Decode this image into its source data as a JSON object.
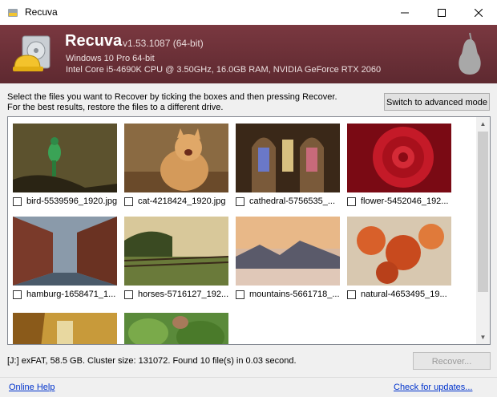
{
  "window": {
    "title": "Recuva"
  },
  "header": {
    "app_name": "Recuva",
    "version": "v1.53.1087 (64-bit)",
    "os": "Windows 10 Pro 64-bit",
    "hardware": "Intel Core i5-4690K CPU @ 3.50GHz, 16.0GB RAM, NVIDIA GeForce RTX 2060"
  },
  "instructions": {
    "line1": "Select the files you want to Recover by ticking the boxes and then pressing Recover.",
    "line2": "For the best results, restore the files to a different drive."
  },
  "advanced_button": "Switch to advanced mode",
  "files": [
    {
      "name": "bird-5539596_1920.jpg",
      "checked": false
    },
    {
      "name": "cat-4218424_1920.jpg",
      "checked": false
    },
    {
      "name": "cathedral-5756535_...",
      "checked": false
    },
    {
      "name": "flower-5452046_192...",
      "checked": false
    },
    {
      "name": "hamburg-1658471_1...",
      "checked": false
    },
    {
      "name": "horses-5716127_192...",
      "checked": false
    },
    {
      "name": "mountains-5661718_...",
      "checked": false
    },
    {
      "name": "natural-4653495_19...",
      "checked": false
    }
  ],
  "status": "[J:] exFAT, 58.5 GB. Cluster size: 131072. Found 10 file(s) in 0.03 second.",
  "recover_button": "Recover...",
  "footer": {
    "help_link": "Online Help",
    "update_link": "Check for updates..."
  },
  "colors": {
    "header_bg": "#6a2f36",
    "link": "#0033cc"
  }
}
